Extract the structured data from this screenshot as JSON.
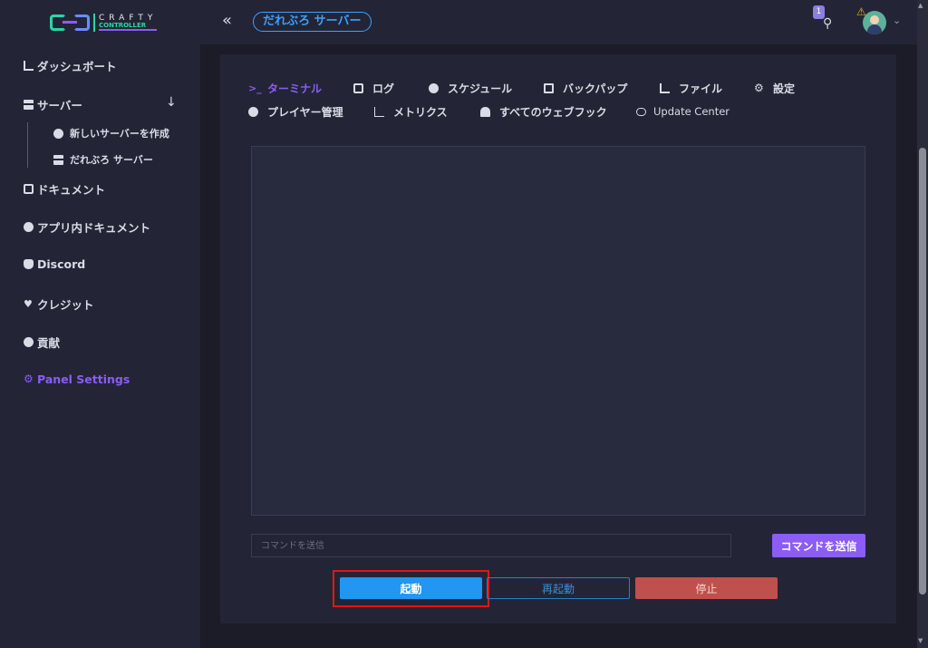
{
  "logo": {
    "line1": "CRAFTY",
    "line2": "CONTROLLER"
  },
  "sidebar": {
    "items": [
      {
        "label": "ダッシュボート",
        "icon": "dashboard-icon"
      },
      {
        "label": "サーバー",
        "icon": "server-icon"
      },
      {
        "label": "ドキュメント",
        "icon": "document-icon"
      },
      {
        "label": "アプリ内ドキュメント",
        "icon": "info-icon"
      },
      {
        "label": "Discord",
        "icon": "discord-icon"
      },
      {
        "label": "クレジット",
        "icon": "heart-icon"
      },
      {
        "label": "貢献",
        "icon": "dollar-icon"
      },
      {
        "label": "Panel Settings",
        "icon": "gear-icon"
      }
    ],
    "sub_items": [
      {
        "label": "新しいサーバーを作成",
        "icon": "plus-circle-icon"
      },
      {
        "label": "だれぶろ サーバー",
        "icon": "server-icon"
      }
    ]
  },
  "topbar": {
    "collapse_glyph": "«",
    "server_name": "だれぶろ サーバー",
    "notification_count": "1"
  },
  "tabs": [
    {
      "label": "ターミナル",
      "icon": "terminal-icon",
      "active": true
    },
    {
      "label": "ログ",
      "icon": "box-icon"
    },
    {
      "label": "スケジュール",
      "icon": "clock-icon"
    },
    {
      "label": "バックパップ",
      "icon": "save-icon"
    },
    {
      "label": "ファイル",
      "icon": "file-tree-icon"
    },
    {
      "label": "設定",
      "icon": "gear-icon"
    },
    {
      "label": "プレイヤー管理",
      "icon": "users-icon"
    },
    {
      "label": "メトリクス",
      "icon": "chart-icon"
    },
    {
      "label": "すべてのウェブフック",
      "icon": "bell-icon"
    },
    {
      "label": "Update Center",
      "icon": "cloud-icon"
    }
  ],
  "command": {
    "placeholder": "コマンドを送信",
    "send_label": "コマンドを送信"
  },
  "actions": {
    "start_label": "起動",
    "restart_label": "再起動",
    "stop_label": "停止"
  },
  "colors": {
    "accent": "#8b5cf6",
    "primary": "#2196f3",
    "danger": "#c0504d",
    "highlight": "#e0161b"
  }
}
